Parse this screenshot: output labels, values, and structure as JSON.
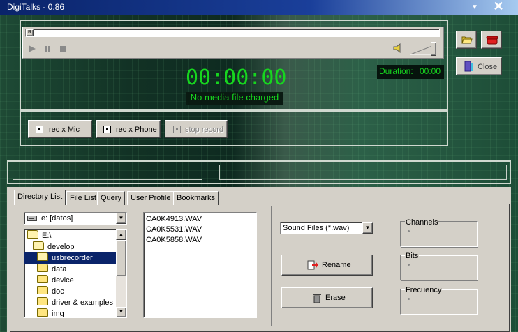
{
  "window": {
    "title": "DigiTalks  -  0.86",
    "dropdown_glyph": "▼",
    "close_glyph": "✕"
  },
  "player": {
    "time": "00:00:00",
    "status": "No media file charged",
    "duration_label": "Duration:",
    "duration_value": "00:00",
    "seek_start_marker": "R",
    "volume_level": 0.85
  },
  "side_buttons": {
    "close_label": "Close"
  },
  "record": {
    "mic_label": "rec x Mic",
    "phone_label": "rec x Phone",
    "stop_label": "stop record"
  },
  "tabs": [
    {
      "label": "Directory List",
      "active": true
    },
    {
      "label": "File List",
      "active": false
    },
    {
      "label": "Query",
      "active": false
    },
    {
      "label": "User Profile",
      "active": false
    },
    {
      "label": "Bookmarks",
      "active": false
    }
  ],
  "drive_select": {
    "value": "e: [datos]"
  },
  "folders": [
    {
      "label": "E:\\",
      "open": true,
      "selected": false
    },
    {
      "label": "develop",
      "open": true,
      "selected": false
    },
    {
      "label": "usbrecorder",
      "open": true,
      "selected": true
    },
    {
      "label": "data",
      "open": false,
      "selected": false
    },
    {
      "label": "device",
      "open": false,
      "selected": false
    },
    {
      "label": "doc",
      "open": false,
      "selected": false
    },
    {
      "label": "driver & examples",
      "open": false,
      "selected": false
    },
    {
      "label": "img",
      "open": false,
      "selected": false
    }
  ],
  "files": [
    "CA0K4913.WAV",
    "CA0K5531.WAV",
    "CA0K5858.WAV"
  ],
  "filter_select": {
    "value": "Sound Files (*.wav)"
  },
  "actions": {
    "rename_label": "Rename",
    "erase_label": "Erase"
  },
  "info_groups": {
    "channels": "Channels",
    "bits": "Bits",
    "frecuency": "Frecuency"
  },
  "colors": {
    "led_green": "#17d61f",
    "title_bar": "#0a246a",
    "selection": "#0a246a"
  }
}
